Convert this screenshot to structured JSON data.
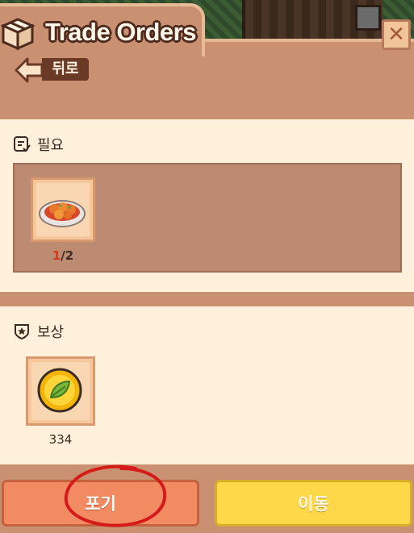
{
  "header": {
    "title": "Trade Orders",
    "close_icon": "close-icon"
  },
  "back": {
    "label": "뒤로",
    "icon": "arrow-left-icon"
  },
  "requirements": {
    "label": "필요",
    "icon": "checklist-icon",
    "items": [
      {
        "name": "dish-icon",
        "have": "1",
        "need": "/2"
      }
    ]
  },
  "rewards": {
    "label": "보상",
    "icon": "badge-star-icon",
    "items": [
      {
        "name": "leaf-coin-icon",
        "amount": "334"
      }
    ]
  },
  "actions": {
    "give_up": "포기",
    "move": "이동"
  },
  "colors": {
    "give_up_button": "#f28a62",
    "move_button": "#ffd84a",
    "panel": "#c99171",
    "card": "#fff0dc",
    "annotation": "#d51a1a"
  }
}
